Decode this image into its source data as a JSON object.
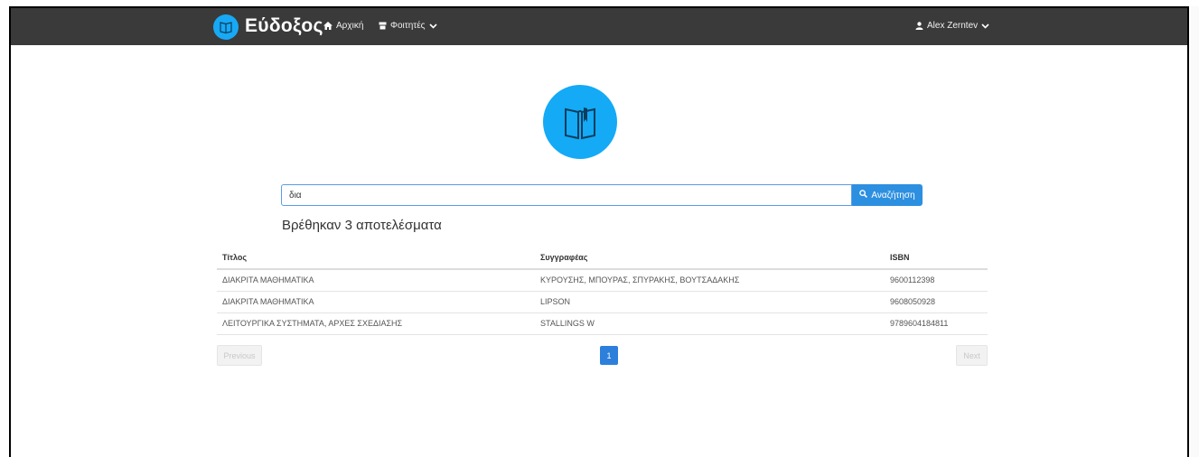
{
  "navbar": {
    "brand": "Εύδοξος",
    "home_label": "Αρχική",
    "students_label": "Φοιτητές",
    "user_label": "Alex Zerntev",
    "background": "#3a3a3a"
  },
  "icons": {
    "brand": "book-logo-icon",
    "home": "home-icon",
    "students": "student-icon",
    "user": "user-icon",
    "dropdown": "chevron-down-icon",
    "hero": "open-book-icon",
    "search": "search-icon"
  },
  "search": {
    "value": "δια",
    "button_label": "Αναζήτηση"
  },
  "results": {
    "heading": "Βρέθηκαν 3 αποτελέσματα",
    "columns": [
      "Τίτλος",
      "Συγγραφέας",
      "ISBN"
    ],
    "rows": [
      {
        "title": "ΔΙΑΚΡΙΤΑ ΜΑΘΗΜΑΤΙΚΑ",
        "author": "ΚΥΡΟΥΣΗΣ, ΜΠΟΥΡΑΣ, ΣΠΥΡΑΚΗΣ, ΒΟΥΤΣΑΔΑΚΗΣ",
        "isbn": "9600112398"
      },
      {
        "title": "ΔΙΑΚΡΙΤΑ ΜΑΘΗΜΑΤΙΚΑ",
        "author": "LIPSON",
        "isbn": "9608050928"
      },
      {
        "title": "ΛΕΙΤΟΥΡΓΙΚΑ ΣΥΣΤΗΜΑΤΑ, ΑΡΧΕΣ ΣΧΕΔΙΑΣΗΣ",
        "author": "STALLINGS W",
        "isbn": "9789604184811"
      }
    ]
  },
  "pagination": {
    "previous_label": "Previous",
    "current_page": "1",
    "next_label": "Next"
  },
  "colors": {
    "accent": "#2d8fe0",
    "logo_blue": "#14aaf5"
  }
}
